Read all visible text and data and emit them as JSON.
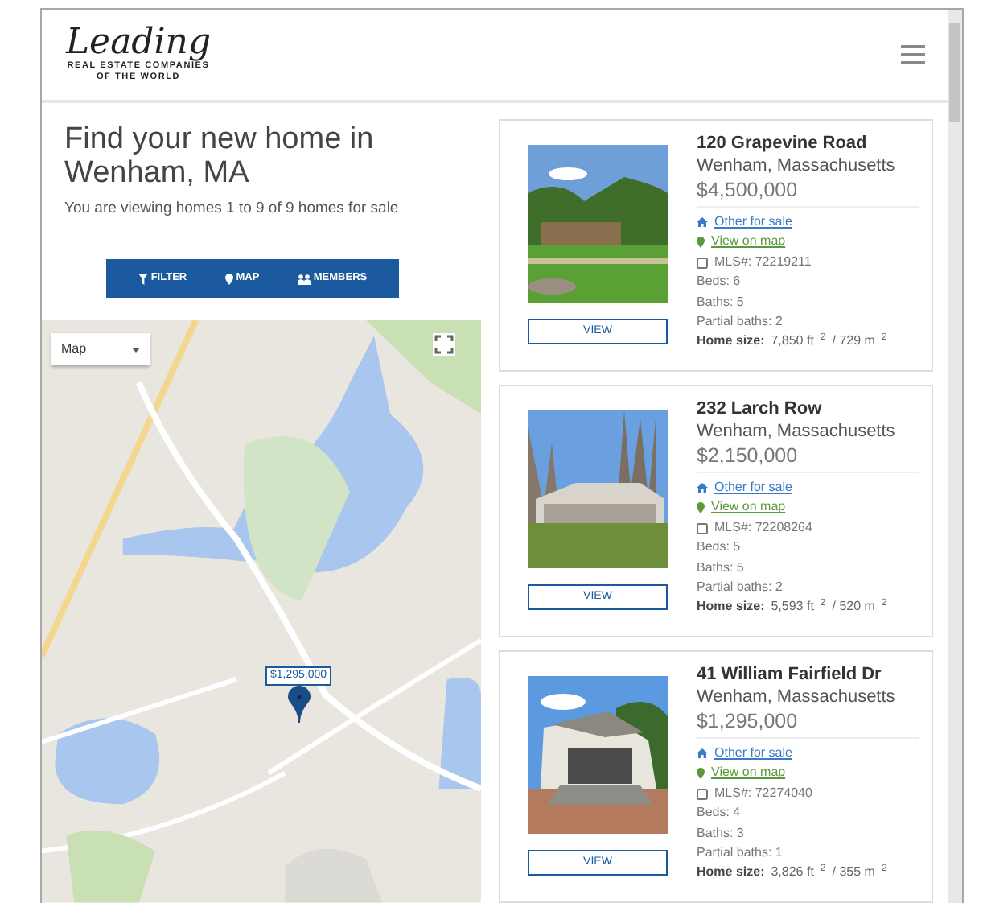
{
  "header": {
    "logo_title": "Leading",
    "logo_subtitle": "REAL ESTATE COMPANIES",
    "logo_subtitle_2": "OF THE WORLD"
  },
  "heading": "Find your new home in Wenham, MA",
  "summary": "You are viewing homes 1 to 9 of 9 homes for sale",
  "toolbar": [
    {
      "label": "FILTER",
      "kind": "filter"
    },
    {
      "label": "MAP",
      "kind": "map"
    },
    {
      "label": "MEMBERS",
      "kind": "members"
    }
  ],
  "map": {
    "type_select": "Map",
    "marker_price": "$1,295,000"
  },
  "listings": [
    {
      "address": "120 Grapevine Road",
      "city": "Wenham, Massachusetts",
      "price": "$4,500,000",
      "category": "Other for sale",
      "map_link": "View on map",
      "mls": "MLS#: 72219211",
      "beds": "Beds: 6",
      "baths": "Baths: 5",
      "partial_baths": "Partial baths: 2",
      "size": "**Home size:** 7,850 ft$^{2}$ / 729 m$^{2}$",
      "button": "VIEW"
    },
    {
      "address": "232 Larch Row",
      "city": "Wenham, Massachusetts",
      "price": "$2,150,000",
      "category": "Other for sale",
      "map_link": "View on map",
      "mls": "MLS#: 72208264",
      "beds": "Beds: 5",
      "baths": "Baths: 5",
      "partial_baths": "Partial baths: 2",
      "size": "**Home size:** 5,593 ft$^{2}$ / 520 m$^{2}$",
      "button": "VIEW"
    },
    {
      "address": "41 William Fairfield Dr",
      "city": "Wenham, Massachusetts",
      "price": "$1,295,000",
      "category": "Other for sale",
      "map_link": "View on map",
      "mls": "MLS#: 72274040",
      "beds": "Beds: 4",
      "baths": "Baths: 3",
      "partial_baths": "Partial baths: 1",
      "size": "**Home size:** 3,826 ft$^{2}$ / 355 m$^{2}$",
      "button": "VIEW"
    }
  ]
}
